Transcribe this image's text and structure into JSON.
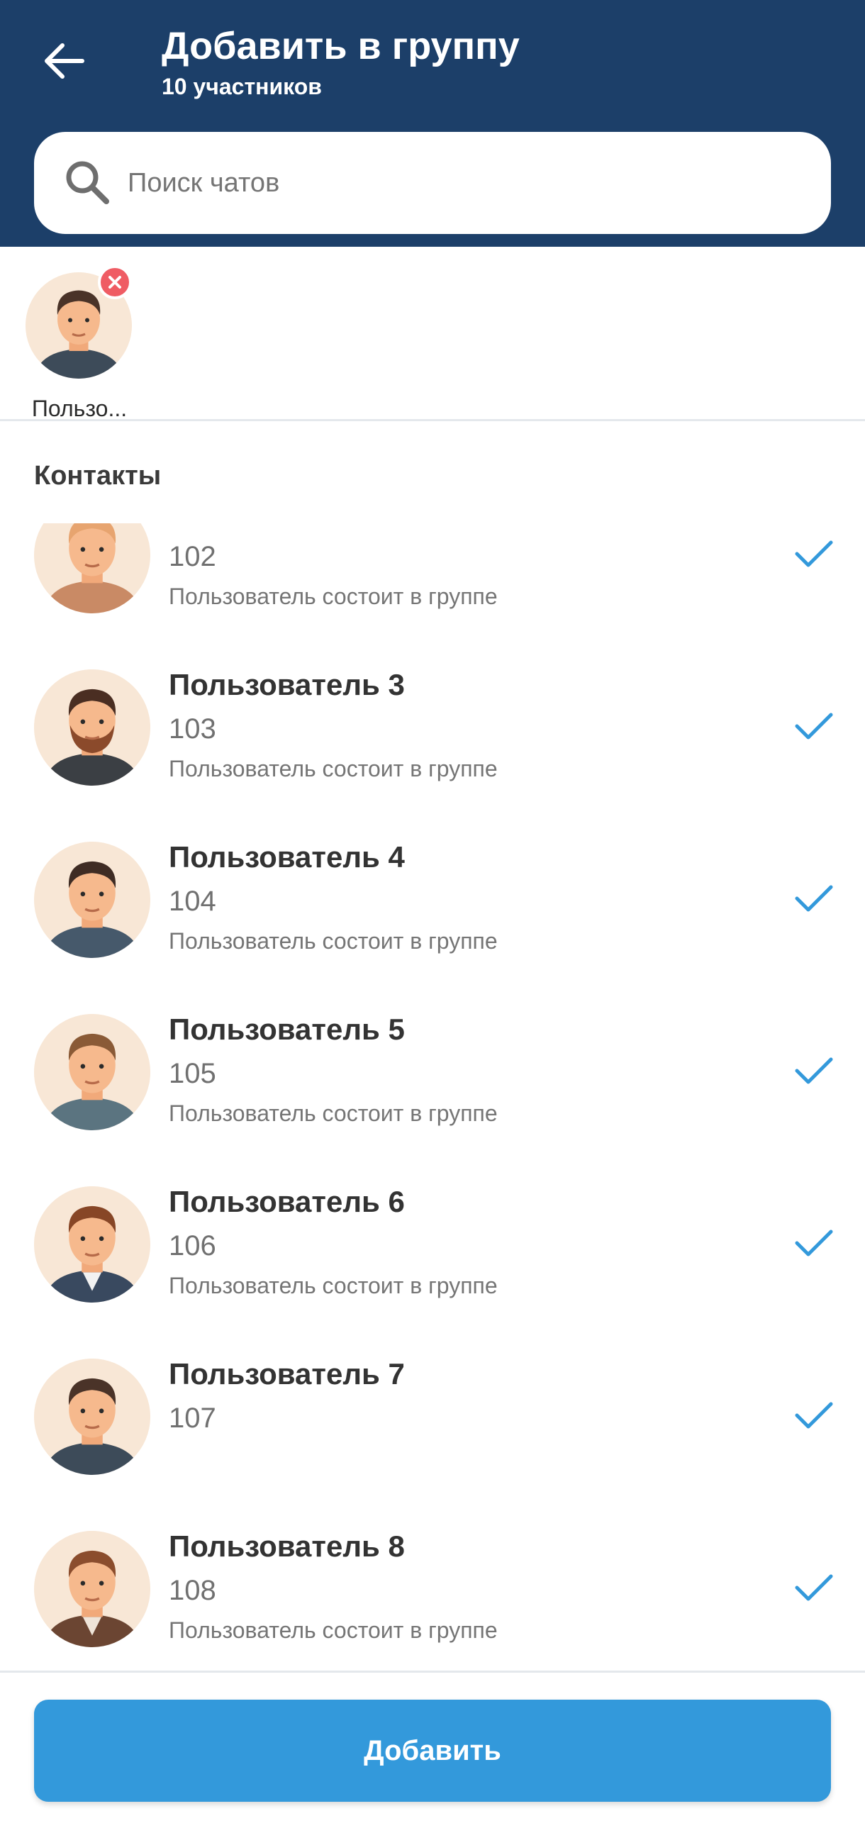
{
  "header": {
    "title": "Добавить в группу",
    "subtitle": "10 участников",
    "back_icon": "arrow-left-icon",
    "bg_color": "#1c3f69"
  },
  "search": {
    "placeholder": "Поиск чатов",
    "value": "",
    "icon": "search-icon"
  },
  "selected": [
    {
      "label": "Пользо...",
      "avatar": "avatar-man",
      "remove_icon": "close-icon",
      "remove_color": "#ef5c64"
    }
  ],
  "section_title": "Контакты",
  "contacts": [
    {
      "name": "",
      "number": "102",
      "status": "Пользователь состоит в группе",
      "selected": true,
      "shirt": "#c98a65",
      "hair": "#e7a46f",
      "beard": false
    },
    {
      "name": "Пользователь 3",
      "number": "103",
      "status": "Пользователь состоит в группе",
      "selected": true,
      "shirt": "#3b3f44",
      "hair": "#4a2e22",
      "beard": true
    },
    {
      "name": "Пользователь 4",
      "number": "104",
      "status": "Пользователь состоит в группе",
      "selected": true,
      "shirt": "#46596b",
      "hair": "#3f2c24",
      "beard": false
    },
    {
      "name": "Пользователь 5",
      "number": "105",
      "status": "Пользователь состоит в группе",
      "selected": true,
      "shirt": "#5b7480",
      "hair": "#8a5a36",
      "beard": false
    },
    {
      "name": "Пользователь 6",
      "number": "106",
      "status": "Пользователь состоит в группе",
      "selected": true,
      "shirt": "#39495f",
      "hair": "#874626",
      "beard": false
    },
    {
      "name": "Пользователь 7",
      "number": "107",
      "status": "",
      "selected": true,
      "shirt": "#3d4b59",
      "hair": "#4a3328",
      "beard": false
    },
    {
      "name": "Пользователь 8",
      "number": "108",
      "status": "Пользователь состоит в группе",
      "selected": true,
      "shirt": "#6b4532",
      "hair": "#8b4d2d",
      "beard": false
    }
  ],
  "check_color": "#3399db",
  "add_button": {
    "label": "Добавить",
    "color": "#3399db"
  }
}
